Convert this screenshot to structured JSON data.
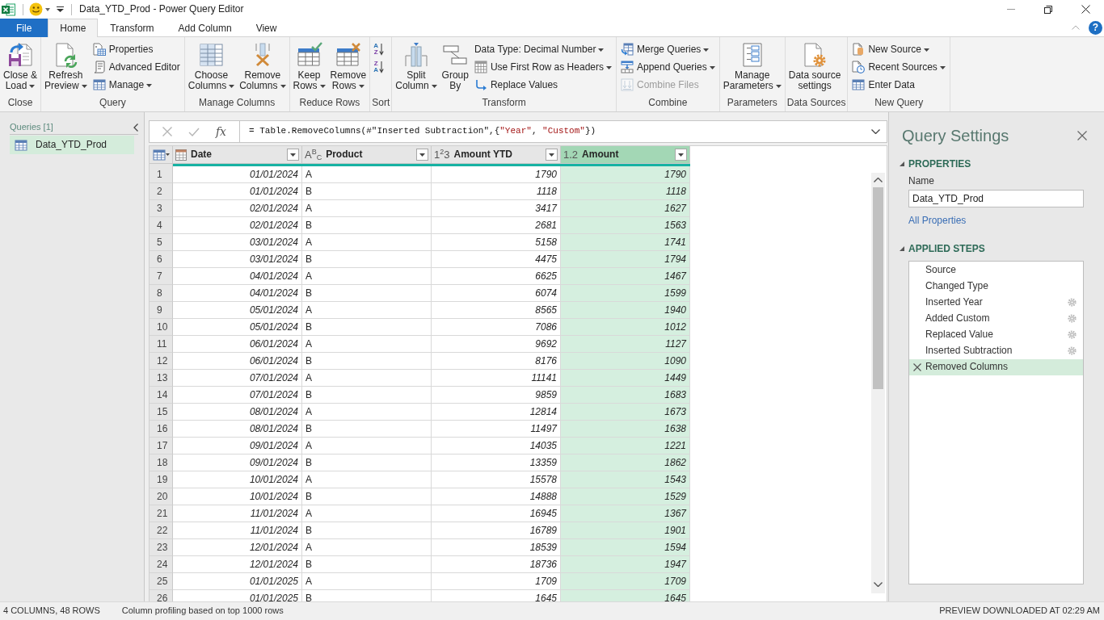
{
  "window": {
    "title": "Data_YTD_Prod - Power Query Editor"
  },
  "tabs": [
    {
      "label": "File",
      "kind": "file",
      "selected": false
    },
    {
      "label": "Home",
      "kind": "tab",
      "selected": true
    },
    {
      "label": "Transform",
      "kind": "tab",
      "selected": false
    },
    {
      "label": "Add Column",
      "kind": "tab",
      "selected": false
    },
    {
      "label": "View",
      "kind": "tab",
      "selected": false
    }
  ],
  "help": "?",
  "ribbon": {
    "groups": [
      {
        "label": "Close",
        "items": [
          {
            "kind": "large",
            "label": "Close &\nLoad",
            "dropdown": true,
            "disabled": false
          }
        ]
      },
      {
        "label": "Query",
        "items": [
          {
            "kind": "large",
            "label": "Refresh\nPreview",
            "dropdown": true,
            "disabled": false
          },
          {
            "kind": "small",
            "label": "Properties",
            "dropdown": false,
            "disabled": false
          },
          {
            "kind": "small",
            "label": "Advanced Editor",
            "dropdown": false,
            "disabled": false
          },
          {
            "kind": "small",
            "label": "Manage",
            "dropdown": true,
            "disabled": false
          }
        ]
      },
      {
        "label": "Manage Columns",
        "items": [
          {
            "kind": "large",
            "label": "Choose\nColumns",
            "dropdown": true,
            "disabled": false
          },
          {
            "kind": "large",
            "label": "Remove\nColumns",
            "dropdown": true,
            "disabled": false
          }
        ]
      },
      {
        "label": "Reduce Rows",
        "items": [
          {
            "kind": "large",
            "label": "Keep\nRows",
            "dropdown": true,
            "disabled": false
          },
          {
            "kind": "large",
            "label": "Remove\nRows",
            "dropdown": true,
            "disabled": false
          }
        ]
      },
      {
        "label": "Sort",
        "items": [
          {
            "kind": "sort",
            "letters": [
              "A",
              "Z"
            ],
            "disabled": false
          },
          {
            "kind": "sort",
            "letters": [
              "Z",
              "A"
            ],
            "disabled": false
          }
        ]
      },
      {
        "label": "Transform",
        "items": [
          {
            "kind": "large",
            "label": "Split\nColumn",
            "dropdown": true,
            "disabled": false
          },
          {
            "kind": "large",
            "label": "Group\nBy",
            "dropdown": false,
            "disabled": false
          },
          {
            "kind": "small",
            "label": "Data Type: Decimal Number",
            "dropdown": true,
            "disabled": false
          },
          {
            "kind": "small",
            "label": "Use First Row as Headers",
            "dropdown": true,
            "disabled": false
          },
          {
            "kind": "small",
            "label": "Replace Values",
            "dropdown": false,
            "disabled": false
          }
        ]
      },
      {
        "label": "Combine",
        "items": [
          {
            "kind": "small",
            "label": "Merge Queries",
            "dropdown": true,
            "disabled": false
          },
          {
            "kind": "small",
            "label": "Append Queries",
            "dropdown": true,
            "disabled": false
          },
          {
            "kind": "small",
            "label": "Combine Files",
            "dropdown": false,
            "disabled": true
          }
        ]
      },
      {
        "label": "Parameters",
        "items": [
          {
            "kind": "large",
            "label": "Manage\nParameters",
            "dropdown": true,
            "disabled": false
          }
        ]
      },
      {
        "label": "Data Sources",
        "items": [
          {
            "kind": "large",
            "label": "Data source\nsettings",
            "dropdown": false,
            "disabled": false
          }
        ]
      },
      {
        "label": "New Query",
        "items": [
          {
            "kind": "small",
            "label": "New Source",
            "dropdown": true,
            "disabled": false
          },
          {
            "kind": "small",
            "label": "Recent Sources",
            "dropdown": true,
            "disabled": false
          },
          {
            "kind": "small",
            "label": "Enter Data",
            "dropdown": false,
            "disabled": false
          }
        ]
      }
    ]
  },
  "queries_panel": {
    "title": "Queries [1]",
    "items": [
      {
        "label": "Data_YTD_Prod",
        "selected": true
      }
    ]
  },
  "formula_bar": {
    "fx": "fx",
    "tokens": [
      {
        "kind": "code",
        "text": "= Table.RemoveColumns(#\"Inserted Subtraction\",{"
      },
      {
        "kind": "string",
        "text": "\"Year\""
      },
      {
        "kind": "code",
        "text": ", "
      },
      {
        "kind": "string",
        "text": "\"Custom\""
      },
      {
        "kind": "code",
        "text": "})"
      }
    ]
  },
  "table": {
    "columns": [
      {
        "name": "Date",
        "kind": "date",
        "selected": false
      },
      {
        "name": "Product",
        "kind": "text",
        "type_label": "A$^{B}$$_{C}$",
        "selected": false
      },
      {
        "name": "Amount YTD",
        "kind": "whole",
        "type_label": "1$^{2}$3",
        "selected": false
      },
      {
        "name": "Amount",
        "kind": "decimal",
        "type_label": "1.2",
        "selected": true
      }
    ],
    "rows": [
      {
        "number": "1",
        "cells": [
          "01/01/2024",
          "A",
          "1790",
          "1790"
        ]
      },
      {
        "number": "2",
        "cells": [
          "01/01/2024",
          "B",
          "1118",
          "1118"
        ]
      },
      {
        "number": "3",
        "cells": [
          "02/01/2024",
          "A",
          "3417",
          "1627"
        ]
      },
      {
        "number": "4",
        "cells": [
          "02/01/2024",
          "B",
          "2681",
          "1563"
        ]
      },
      {
        "number": "5",
        "cells": [
          "03/01/2024",
          "A",
          "5158",
          "1741"
        ]
      },
      {
        "number": "6",
        "cells": [
          "03/01/2024",
          "B",
          "4475",
          "1794"
        ]
      },
      {
        "number": "7",
        "cells": [
          "04/01/2024",
          "A",
          "6625",
          "1467"
        ]
      },
      {
        "number": "8",
        "cells": [
          "04/01/2024",
          "B",
          "6074",
          "1599"
        ]
      },
      {
        "number": "9",
        "cells": [
          "05/01/2024",
          "A",
          "8565",
          "1940"
        ]
      },
      {
        "number": "10",
        "cells": [
          "05/01/2024",
          "B",
          "7086",
          "1012"
        ]
      },
      {
        "number": "11",
        "cells": [
          "06/01/2024",
          "A",
          "9692",
          "1127"
        ]
      },
      {
        "number": "12",
        "cells": [
          "06/01/2024",
          "B",
          "8176",
          "1090"
        ]
      },
      {
        "number": "13",
        "cells": [
          "07/01/2024",
          "A",
          "11141",
          "1449"
        ]
      },
      {
        "number": "14",
        "cells": [
          "07/01/2024",
          "B",
          "9859",
          "1683"
        ]
      },
      {
        "number": "15",
        "cells": [
          "08/01/2024",
          "A",
          "12814",
          "1673"
        ]
      },
      {
        "number": "16",
        "cells": [
          "08/01/2024",
          "B",
          "11497",
          "1638"
        ]
      },
      {
        "number": "17",
        "cells": [
          "09/01/2024",
          "A",
          "14035",
          "1221"
        ]
      },
      {
        "number": "18",
        "cells": [
          "09/01/2024",
          "B",
          "13359",
          "1862"
        ]
      },
      {
        "number": "19",
        "cells": [
          "10/01/2024",
          "A",
          "15578",
          "1543"
        ]
      },
      {
        "number": "20",
        "cells": [
          "10/01/2024",
          "B",
          "14888",
          "1529"
        ]
      },
      {
        "number": "21",
        "cells": [
          "11/01/2024",
          "A",
          "16945",
          "1367"
        ]
      },
      {
        "number": "22",
        "cells": [
          "11/01/2024",
          "B",
          "16789",
          "1901"
        ]
      },
      {
        "number": "23",
        "cells": [
          "12/01/2024",
          "A",
          "18539",
          "1594"
        ]
      },
      {
        "number": "24",
        "cells": [
          "12/01/2024",
          "B",
          "18736",
          "1947"
        ]
      },
      {
        "number": "25",
        "cells": [
          "01/01/2025",
          "A",
          "1709",
          "1709"
        ]
      },
      {
        "number": "26",
        "cells": [
          "01/01/2025",
          "B",
          "1645",
          "1645"
        ]
      }
    ]
  },
  "query_settings": {
    "title": "Query Settings",
    "properties_heading": "PROPERTIES",
    "name_label": "Name",
    "name_value": "Data_YTD_Prod",
    "all_properties": "All Properties",
    "steps_heading": "APPLIED STEPS",
    "steps": [
      {
        "label": "Source",
        "has_settings": false,
        "selected": false
      },
      {
        "label": "Changed Type",
        "has_settings": false,
        "selected": false
      },
      {
        "label": "Inserted Year",
        "has_settings": true,
        "selected": false
      },
      {
        "label": "Added Custom",
        "has_settings": true,
        "selected": false
      },
      {
        "label": "Replaced Value",
        "has_settings": true,
        "selected": false
      },
      {
        "label": "Inserted Subtraction",
        "has_settings": true,
        "selected": false
      },
      {
        "label": "Removed Columns",
        "has_settings": false,
        "selected": true
      }
    ]
  },
  "status_bar": {
    "left": [
      "4 COLUMNS, 48 ROWS",
      "Column profiling based on top 1000 rows"
    ],
    "right": "PREVIEW DOWNLOADED AT 02:29 AM"
  }
}
